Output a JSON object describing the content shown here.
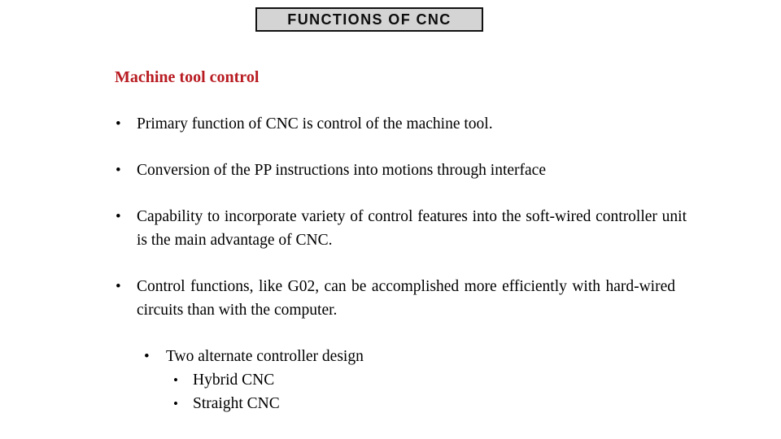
{
  "slide": {
    "title_box": {
      "text": "FUNCTIONS OF CNC",
      "background_color": "#d4d4d4",
      "border_color": "#101010",
      "text_color": "#0d0d0d"
    },
    "heading": {
      "text": "Machine tool control",
      "color": "#b81c22"
    },
    "background_color": "#ffffff",
    "body_text_color": "#000000",
    "bullet_marker": "•",
    "bullets": [
      {
        "level": 1,
        "marker": "•",
        "text": "Primary function of  CNC is control of the machine tool.",
        "wraps": false
      },
      {
        "level": 1,
        "marker": "•",
        "text": "Conversion of the PP instructions into motions through interface",
        "wraps": false
      },
      {
        "level": 1,
        "marker": "•",
        "text": "Capability to incorporate variety of control features into the soft-wired controller unit is the main advantage of CNC.",
        "wraps": true,
        "line1": "Capability to incorporate variety of control features into the soft-",
        "line2": "wired controller unit is the main advantage of CNC."
      },
      {
        "level": 1,
        "marker": "•",
        "text": "Control functions, like G02, can be accomplished more efficiently with hard-wired circuits than with the computer.",
        "wraps": true,
        "line1": "Control functions, like G02, can be accomplished more efficiently",
        "line2": "with hard-wired circuits than with the computer."
      },
      {
        "level": 2,
        "marker": "•",
        "text": "Two alternate controller design",
        "wraps": false
      },
      {
        "level": 3,
        "marker": "•",
        "text": "Hybrid CNC",
        "wraps": false
      },
      {
        "level": 3,
        "marker": "•",
        "text": "Straight CNC",
        "wraps": false
      }
    ]
  }
}
